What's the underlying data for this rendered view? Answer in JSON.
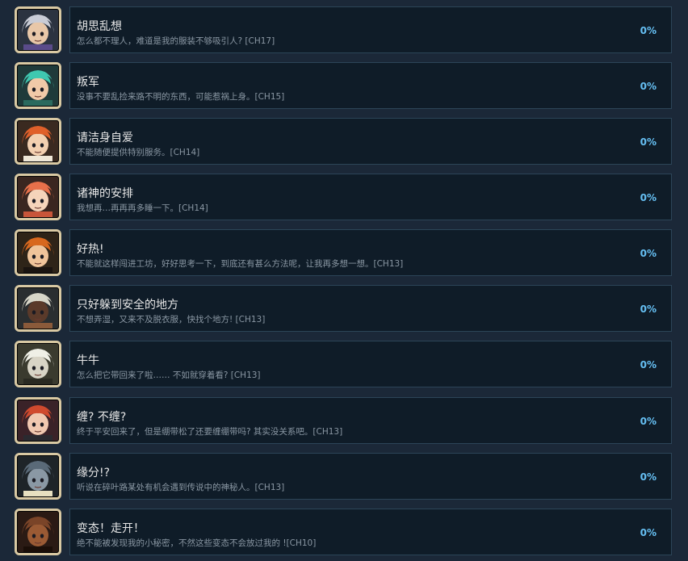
{
  "achievements": [
    {
      "icon": "silver-haired-boy-icon",
      "colors": {
        "bg": "#2b3340",
        "hair": "#c9ccd6",
        "skin": "#e8c7a8",
        "accent": "#5a4b8a"
      },
      "title": "胡思乱想",
      "desc": "怎么都不理人，难道是我的服装不够吸引人? [CH17]",
      "progress": "0%"
    },
    {
      "icon": "teal-haired-girl-icon",
      "colors": {
        "bg": "#1f3a3a",
        "hair": "#3fc8b0",
        "skin": "#f0c9a8",
        "accent": "#2a6a5e"
      },
      "title": "叛军",
      "desc": "没事不要乱捡来路不明的东西，可能惹祸上身。[CH15]",
      "progress": "0%"
    },
    {
      "icon": "blushing-redhead-icon",
      "colors": {
        "bg": "#3a2a20",
        "hair": "#e0602a",
        "skin": "#f3d0b0",
        "accent": "#f0e8d8"
      },
      "title": "请洁身自爱",
      "desc": "不能随便提供特别服务。[CH14]",
      "progress": "0%"
    },
    {
      "icon": "sleepy-catgirl-icon",
      "colors": {
        "bg": "#3a2620",
        "hair": "#e8704a",
        "skin": "#f5d4ba",
        "accent": "#c8553a"
      },
      "title": "诸神的安排",
      "desc": "我想再…再再再多睡一下。[CH14]",
      "progress": "0%"
    },
    {
      "icon": "fox-ears-girl-icon",
      "colors": {
        "bg": "#2e2418",
        "hair": "#d8681e",
        "skin": "#f0c49a",
        "accent": "#1a1410"
      },
      "title": "好热!",
      "desc": "不能就这样闯进工坊，好好思考一下，到底还有甚么方法呢，让我再多想一想。[CH13]",
      "progress": "0%"
    },
    {
      "icon": "moon-barrel-icon",
      "colors": {
        "bg": "#2a2e30",
        "hair": "#d8d6c8",
        "skin": "#5a3a2a",
        "accent": "#8a5a3a"
      },
      "title": "只好躲到安全的地方",
      "desc": "不想弄湿，又来不及脱衣服，快找个地方! [CH13]",
      "progress": "0%"
    },
    {
      "icon": "goat-head-icon",
      "colors": {
        "bg": "#3a3a2e",
        "hair": "#efefe6",
        "skin": "#d8d4c6",
        "accent": "#2a2a22"
      },
      "title": "牛牛",
      "desc": "怎么把它带回来了啦…… 不如就穿着看? [CH13]",
      "progress": "0%"
    },
    {
      "icon": "redhead-collar-girl-icon",
      "colors": {
        "bg": "#3a2228",
        "hair": "#d04a2e",
        "skin": "#f0c8b0",
        "accent": "#2a2a30"
      },
      "title": "缠? 不缠?",
      "desc": "终于平安回来了，但是绷带松了还要缠绷带吗? 其实没关系吧。[CH13]",
      "progress": "0%"
    },
    {
      "icon": "dark-owl-icon",
      "colors": {
        "bg": "#1e2428",
        "hair": "#5a6a78",
        "skin": "#8a98a4",
        "accent": "#e8e0c0"
      },
      "title": "缘分!?",
      "desc": "听说在碎叶路某处有机会遇到传说中的神秘人。[CH13]",
      "progress": "0%"
    },
    {
      "icon": "brown-beast-icon",
      "colors": {
        "bg": "#2a1a14",
        "hair": "#7a4428",
        "skin": "#9a5a34",
        "accent": "#1a0e08"
      },
      "title": "变态！走开！",
      "desc": "绝不能被发现我的小秘密，不然这些变态不会放过我的 ![CH10]",
      "progress": "0%"
    }
  ]
}
